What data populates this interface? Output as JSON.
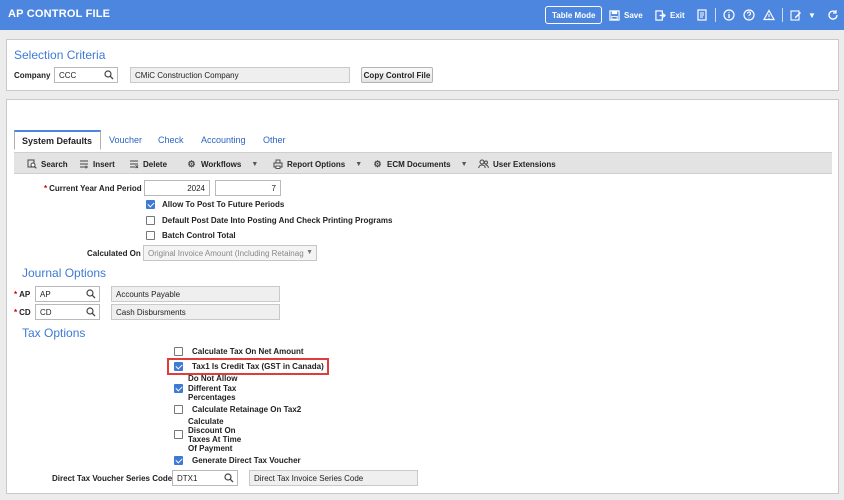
{
  "app": {
    "title": "AP CONTROL FILE",
    "table_mode_label": "Table Mode",
    "save_label": "Save",
    "exit_label": "Exit"
  },
  "selection": {
    "title": "Selection Criteria",
    "company_label": "Company",
    "company_value": "CCC",
    "company_name": "CMiC Construction Company",
    "copy_button": "Copy Control File"
  },
  "tabs": [
    {
      "label": "System Defaults",
      "active": true
    },
    {
      "label": "Voucher"
    },
    {
      "label": "Check"
    },
    {
      "label": "Accounting"
    },
    {
      "label": "Other"
    }
  ],
  "toolbar": {
    "search": "Search",
    "insert": "Insert",
    "delete": "Delete",
    "workflows": "Workflows",
    "report_options": "Report Options",
    "ecm_documents": "ECM Documents",
    "user_extensions": "User Extensions"
  },
  "defaults": {
    "year_period_label": "Current Year And Period",
    "year_value": "2024",
    "period_value": "7",
    "allow_future_label": "Allow To Post To Future Periods",
    "allow_future_checked": true,
    "default_post_date_label": "Default Post Date Into Posting And Check Printing Programs",
    "default_post_date_checked": false,
    "batch_control_label": "Batch Control Total",
    "batch_control_checked": false,
    "calculated_on_label": "Calculated On",
    "calculated_on_value": "Original Invoice Amount (Including Retainage"
  },
  "journal": {
    "title": "Journal Options",
    "ap_label": "AP",
    "ap_value": "AP",
    "ap_desc": "Accounts Payable",
    "cd_label": "CD",
    "cd_value": "CD",
    "cd_desc": "Cash Disbursments"
  },
  "tax": {
    "title": "Tax Options",
    "calc_net_label": "Calculate Tax On Net Amount",
    "calc_net_checked": false,
    "tax1_credit_label": "Tax1 Is Credit Tax (GST in Canada)",
    "tax1_credit_checked": true,
    "no_diff_line1": "Do Not Allow",
    "no_diff_line2": "Different Tax",
    "no_diff_line3": "Percentages",
    "no_diff_checked": true,
    "calc_retainage_label": "Calculate Retainage On Tax2",
    "calc_retainage_checked": false,
    "calc_discount_line1": "Calculate",
    "calc_discount_line2": "Discount On",
    "calc_discount_line3": "Taxes At Time",
    "calc_discount_line4": "Of Payment",
    "calc_discount_checked": false,
    "gen_direct_label": "Generate Direct Tax Voucher",
    "gen_direct_checked": true,
    "series_code_label": "Direct Tax Voucher Series Code",
    "series_code_value": "DTX1",
    "series_code_desc": "Direct Tax Invoice Series Code"
  }
}
